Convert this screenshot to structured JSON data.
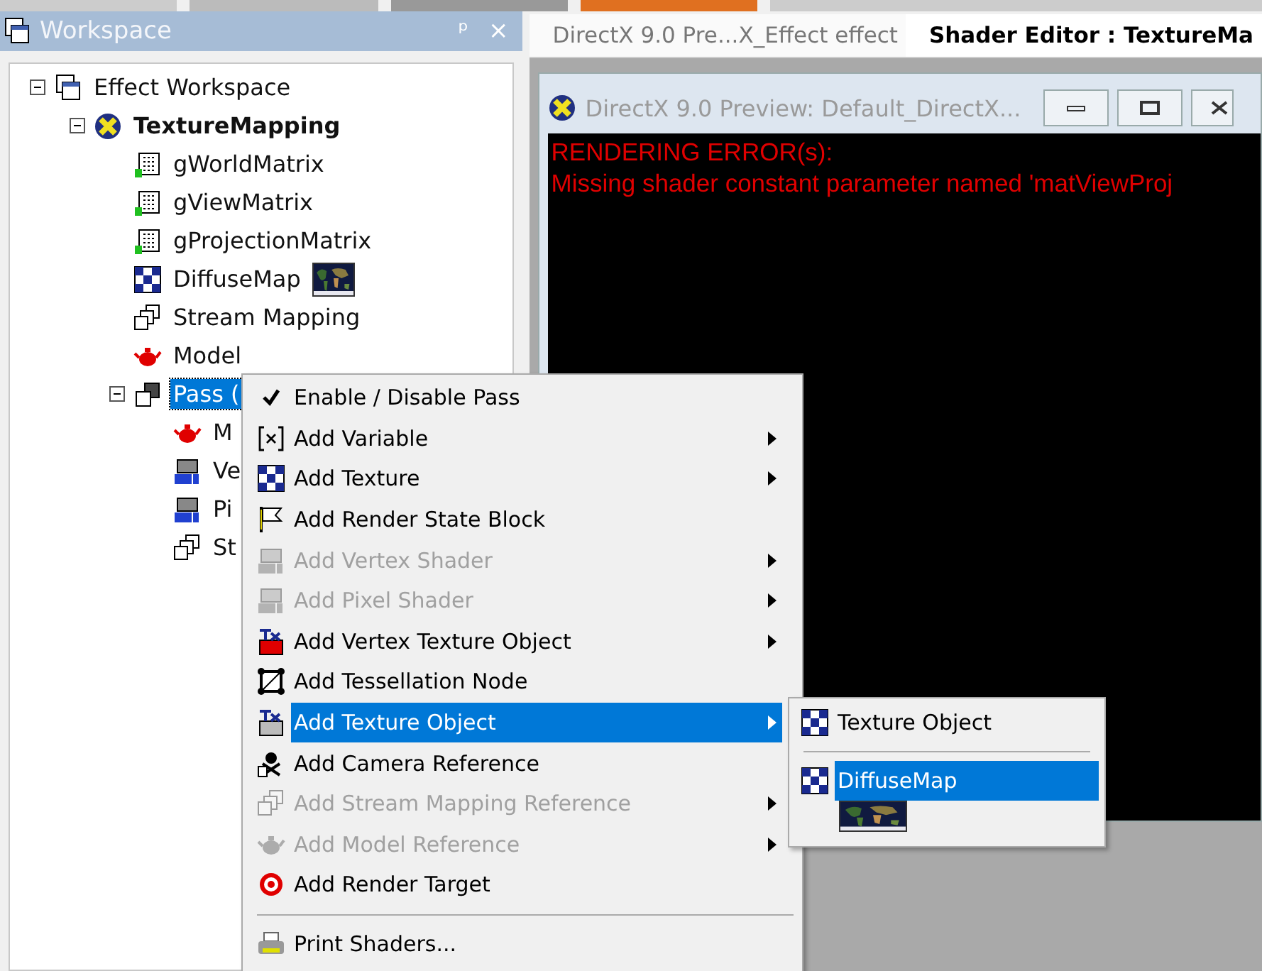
{
  "workspace": {
    "title": "Workspace",
    "pin_glyph": "ᵖ",
    "close_glyph": "×"
  },
  "tree": [
    {
      "label": "Effect Workspace",
      "expanded": true,
      "selected": false,
      "children": [
        {
          "label": "TextureMapping",
          "expanded": true,
          "selected": false,
          "children": [
            {
              "label": "gWorldMatrix",
              "selected": false
            },
            {
              "label": "gViewMatrix",
              "selected": false
            },
            {
              "label": "gProjectionMatrix",
              "selected": false
            },
            {
              "label": "DiffuseMap",
              "selected": false
            },
            {
              "label": "Stream Mapping",
              "selected": false
            },
            {
              "label": "Model",
              "selected": false
            },
            {
              "label": "Pass (",
              "expanded": true,
              "selected": true,
              "children": [
                {
                  "label": "M",
                  "selected": false
                },
                {
                  "label": "Ve",
                  "selected": false
                },
                {
                  "label": "Pi",
                  "selected": false
                },
                {
                  "label": "St",
                  "selected": false
                }
              ]
            }
          ]
        }
      ]
    }
  ],
  "tabs": [
    {
      "label": "DirectX 9.0 Pre...X_Effect effect",
      "selected": false
    },
    {
      "label": "Shader Editor : TextureMa",
      "selected": true
    }
  ],
  "preview": {
    "title": "DirectX 9.0 Preview: Default_DirectX...",
    "errors": [
      "RENDERING ERROR(s):",
      "Missing shader constant parameter named 'matViewProj"
    ]
  },
  "context_menu": [
    {
      "kind": "item",
      "label": "Enable / Disable Pass",
      "checked": true,
      "disabled": false,
      "submenu": false,
      "selected": false
    },
    {
      "kind": "item",
      "label": "Add Variable",
      "checked": false,
      "disabled": false,
      "submenu": true,
      "selected": false
    },
    {
      "kind": "item",
      "label": "Add Texture",
      "checked": false,
      "disabled": false,
      "submenu": true,
      "selected": false
    },
    {
      "kind": "item",
      "label": "Add Render State Block",
      "checked": false,
      "disabled": false,
      "submenu": false,
      "selected": false
    },
    {
      "kind": "item",
      "label": "Add Vertex Shader",
      "checked": false,
      "disabled": true,
      "submenu": true,
      "selected": false
    },
    {
      "kind": "item",
      "label": "Add Pixel Shader",
      "checked": false,
      "disabled": true,
      "submenu": true,
      "selected": false
    },
    {
      "kind": "item",
      "label": "Add Vertex Texture Object",
      "checked": false,
      "disabled": false,
      "submenu": true,
      "selected": false
    },
    {
      "kind": "item",
      "label": "Add Tessellation Node",
      "checked": false,
      "disabled": false,
      "submenu": false,
      "selected": false
    },
    {
      "kind": "item",
      "label": "Add Texture Object",
      "checked": false,
      "disabled": false,
      "submenu": true,
      "selected": true
    },
    {
      "kind": "item",
      "label": "Add Camera Reference",
      "checked": false,
      "disabled": false,
      "submenu": false,
      "selected": false
    },
    {
      "kind": "item",
      "label": "Add Stream Mapping Reference",
      "checked": false,
      "disabled": true,
      "submenu": true,
      "selected": false
    },
    {
      "kind": "item",
      "label": "Add Model Reference",
      "checked": false,
      "disabled": true,
      "submenu": true,
      "selected": false
    },
    {
      "kind": "item",
      "label": "Add Render Target",
      "checked": false,
      "disabled": false,
      "submenu": false,
      "selected": false
    },
    {
      "kind": "separator"
    },
    {
      "kind": "item",
      "label": "Print Shaders...",
      "checked": false,
      "disabled": false,
      "submenu": false,
      "selected": false
    }
  ],
  "submenu": [
    {
      "kind": "item",
      "label": "Texture Object",
      "selected": false
    },
    {
      "kind": "separator"
    },
    {
      "kind": "item",
      "label": "DiffuseMap",
      "selected": true
    }
  ]
}
